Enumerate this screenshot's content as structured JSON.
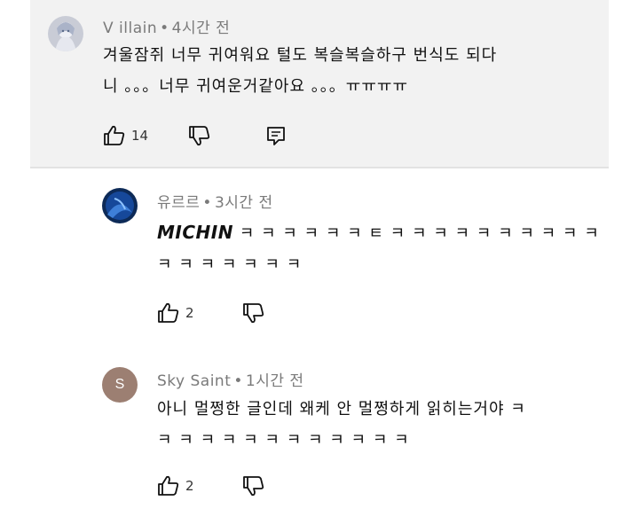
{
  "comments": [
    {
      "author": "V illain",
      "time": "4시간 전",
      "line1": "겨울잠쥐 너무 귀여워요 털도 복슬복슬하구 번식도 되다",
      "line2": "니 。。。너무 귀여운거같아요 。。。ㅠㅠㅠㅠ",
      "likes": "14",
      "avatar_icon": "anime-avatar"
    },
    {
      "author": "유르르",
      "time": "3시간 전",
      "bold_prefix": "MICHIN",
      "line1": "ㅋ ㅋ ㅋ ㅋ ㅋ ㅋ ㅌ ㅋ ㅋ ㅋ ㅋ ㅋ ㅋ ㅋ ㅋ ㅋ ㅋ",
      "line2": "ㅋ ㅋ ㅋ ㅋ ㅋ ㅋ ㅋ",
      "likes": "2",
      "avatar_icon": "blue-photo-avatar"
    },
    {
      "author": "Sky Saint",
      "time": "1시간 전",
      "initial": "S",
      "line1": "아니 멀쩡한 글인데 왜케 안 멀쩡하게 읽히는거야 ㅋ",
      "line2": "ㅋ ㅋ ㅋ ㅋ ㅋ ㅋ ㅋ ㅋ ㅋ ㅋ ㅋ ㅋ",
      "likes": "2",
      "avatar_color": "#9c7f72"
    }
  ]
}
